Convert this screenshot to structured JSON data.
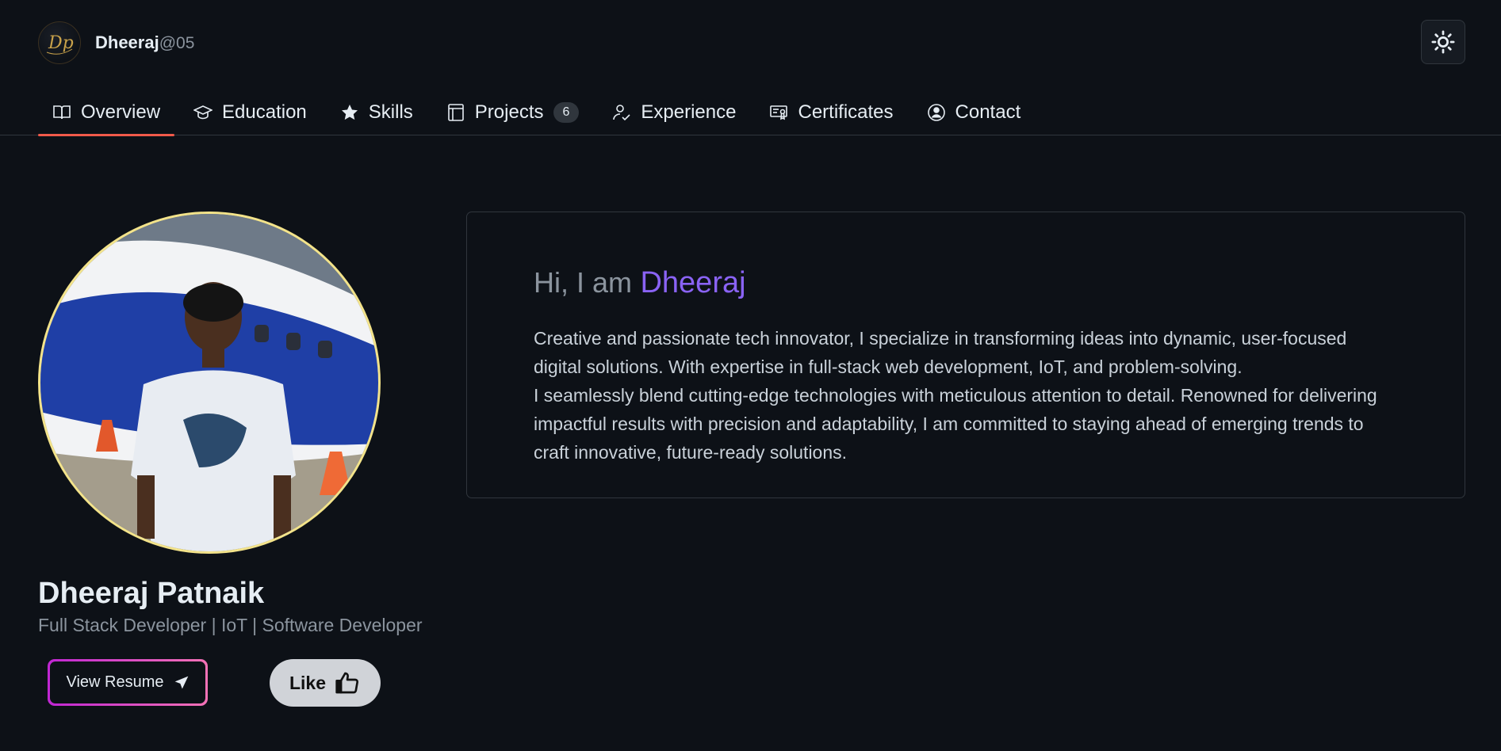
{
  "header": {
    "brand_name": "Dheeraj",
    "brand_handle": "@05",
    "logo_text": "Dp"
  },
  "tabs": [
    {
      "label": "Overview",
      "icon": "book-icon",
      "active": true
    },
    {
      "label": "Education",
      "icon": "graduation-cap-icon"
    },
    {
      "label": "Skills",
      "icon": "star-icon"
    },
    {
      "label": "Projects",
      "icon": "project-icon",
      "badge": "6"
    },
    {
      "label": "Experience",
      "icon": "person-check-icon"
    },
    {
      "label": "Certificates",
      "icon": "certificate-icon"
    },
    {
      "label": "Contact",
      "icon": "person-circle-icon"
    }
  ],
  "profile": {
    "name": "Dheeraj Patnaik",
    "title": "Full Stack Developer | IoT | Software Developer",
    "resume_label": "View Resume",
    "like_label": "Like"
  },
  "intro": {
    "greeting": "Hi, I am",
    "name": "Dheeraj",
    "bio_1": "Creative and passionate tech innovator, I specialize in transforming ideas into dynamic, user-focused digital solutions. With expertise in full-stack web development, IoT, and problem-solving.",
    "bio_2": "I seamlessly blend cutting-edge technologies with meticulous attention to detail. Renowned for delivering impactful results with precision and adaptability, I am committed to staying ahead of emerging trends to craft innovative, future-ready solutions."
  },
  "colors": {
    "background": "#0d1117",
    "active_tab_underline": "#f15a4a",
    "accent_name": "#8a63f5",
    "avatar_border": "#f3e38a"
  }
}
